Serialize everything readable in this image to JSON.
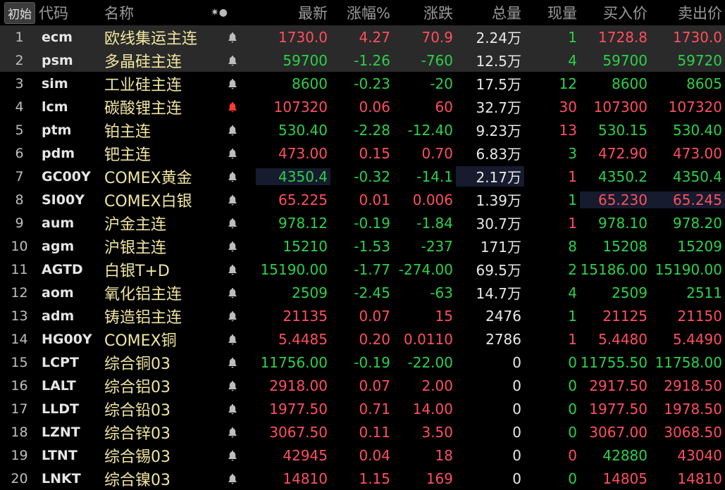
{
  "header": {
    "init_btn": "初始",
    "code": "代码",
    "name": "名称",
    "icons": "✷●",
    "last": "最新",
    "pct": "涨幅%",
    "chg": "涨跌",
    "vol": "总量",
    "cur": "现量",
    "bid": "买入价",
    "ask": "卖出价"
  },
  "colors": {
    "up": "#ff4f5e",
    "down": "#2bd14a",
    "name": "#f0e6a0"
  },
  "rows": [
    {
      "n": "1",
      "code": "ecm",
      "name": "欧线集运主连",
      "last": "1730.0",
      "pct": "4.27",
      "chg": "70.9",
      "vol": "2.24万",
      "cur": "1",
      "bid": "1728.8",
      "ask": "1730.0",
      "dir": "up",
      "curdir": "down",
      "bell": "gray"
    },
    {
      "n": "2",
      "code": "psm",
      "name": "多晶硅主连",
      "last": "59700",
      "pct": "-1.26",
      "chg": "-760",
      "vol": "12.5万",
      "cur": "4",
      "bid": "59700",
      "ask": "59720",
      "dir": "down",
      "curdir": "down",
      "bell": "gray"
    },
    {
      "n": "3",
      "code": "sim",
      "name": "工业硅主连",
      "last": "8600",
      "pct": "-0.23",
      "chg": "-20",
      "vol": "17.5万",
      "cur": "12",
      "bid": "8600",
      "ask": "8605",
      "dir": "down",
      "curdir": "down",
      "bell": "gray"
    },
    {
      "n": "4",
      "code": "lcm",
      "name": "碳酸锂主连",
      "last": "107320",
      "pct": "0.06",
      "chg": "60",
      "vol": "32.7万",
      "cur": "30",
      "bid": "107300",
      "ask": "107320",
      "dir": "up",
      "curdir": "up",
      "bell": "red"
    },
    {
      "n": "5",
      "code": "ptm",
      "name": "铂主连",
      "last": "530.40",
      "pct": "-2.28",
      "chg": "-12.40",
      "vol": "9.23万",
      "cur": "13",
      "bid": "530.15",
      "ask": "530.40",
      "dir": "down",
      "curdir": "up",
      "bell": "gray"
    },
    {
      "n": "6",
      "code": "pdm",
      "name": "钯主连",
      "last": "473.00",
      "pct": "0.15",
      "chg": "0.70",
      "vol": "6.83万",
      "cur": "3",
      "bid": "472.90",
      "ask": "473.00",
      "dir": "up",
      "curdir": "down",
      "bell": "gray"
    },
    {
      "n": "7",
      "code": "GC00Y",
      "name": "COMEX黄金",
      "last": "4350.4",
      "pct": "-0.32",
      "chg": "-14.1",
      "vol": "2.17万",
      "cur": "1",
      "bid": "4350.2",
      "ask": "4350.4",
      "dir": "down",
      "curdir": "up",
      "bell": "gray"
    },
    {
      "n": "8",
      "code": "SI00Y",
      "name": "COMEX白银",
      "last": "65.225",
      "pct": "0.01",
      "chg": "0.006",
      "vol": "1.39万",
      "cur": "1",
      "bid": "65.230",
      "ask": "65.245",
      "dir": "up",
      "curdir": "down",
      "bell": "gray"
    },
    {
      "n": "9",
      "code": "aum",
      "name": "沪金主连",
      "last": "978.12",
      "pct": "-0.19",
      "chg": "-1.84",
      "vol": "30.7万",
      "cur": "1",
      "bid": "978.10",
      "ask": "978.20",
      "dir": "down",
      "curdir": "up",
      "bell": "gray"
    },
    {
      "n": "10",
      "code": "agm",
      "name": "沪银主连",
      "last": "15210",
      "pct": "-1.53",
      "chg": "-237",
      "vol": "171万",
      "cur": "8",
      "bid": "15208",
      "ask": "15209",
      "dir": "down",
      "curdir": "down",
      "bell": "gray"
    },
    {
      "n": "11",
      "code": "AGTD",
      "name": "白银T+D",
      "last": "15190.00",
      "pct": "-1.77",
      "chg": "-274.00",
      "vol": "69.5万",
      "cur": "2",
      "bid": "15186.00",
      "ask": "15190.00",
      "dir": "down",
      "curdir": "down",
      "bell": "gray"
    },
    {
      "n": "12",
      "code": "aom",
      "name": "氧化铝主连",
      "last": "2509",
      "pct": "-2.45",
      "chg": "-63",
      "vol": "14.7万",
      "cur": "4",
      "bid": "2509",
      "ask": "2511",
      "dir": "down",
      "curdir": "down",
      "bell": "gray"
    },
    {
      "n": "13",
      "code": "adm",
      "name": "铸造铝主连",
      "last": "21135",
      "pct": "0.07",
      "chg": "15",
      "vol": "2476",
      "cur": "1",
      "bid": "21125",
      "ask": "21150",
      "dir": "up",
      "curdir": "down",
      "bell": "gray"
    },
    {
      "n": "14",
      "code": "HG00Y",
      "name": "COMEX铜",
      "last": "5.4485",
      "pct": "0.20",
      "chg": "0.0110",
      "vol": "2786",
      "cur": "1",
      "bid": "5.4480",
      "ask": "5.4490",
      "dir": "up",
      "curdir": "up",
      "bell": "gray"
    },
    {
      "n": "15",
      "code": "LCPT",
      "name": "综合铜03",
      "last": "11756.00",
      "pct": "-0.19",
      "chg": "-22.00",
      "vol": "0",
      "cur": "0",
      "bid": "11755.50",
      "ask": "11758.00",
      "dir": "down",
      "curdir": "down",
      "bell": "gray"
    },
    {
      "n": "16",
      "code": "LALT",
      "name": "综合铝03",
      "last": "2918.00",
      "pct": "0.07",
      "chg": "2.00",
      "vol": "0",
      "cur": "0",
      "bid": "2917.50",
      "ask": "2918.50",
      "dir": "up",
      "curdir": "down",
      "bell": "gray"
    },
    {
      "n": "17",
      "code": "LLDT",
      "name": "综合铅03",
      "last": "1977.50",
      "pct": "0.71",
      "chg": "14.00",
      "vol": "0",
      "cur": "0",
      "bid": "1977.50",
      "ask": "1978.50",
      "dir": "up",
      "curdir": "down",
      "bell": "gray"
    },
    {
      "n": "18",
      "code": "LZNT",
      "name": "综合锌03",
      "last": "3067.50",
      "pct": "0.11",
      "chg": "3.50",
      "vol": "0",
      "cur": "0",
      "bid": "3067.00",
      "ask": "3068.50",
      "dir": "up",
      "curdir": "down",
      "bell": "gray"
    },
    {
      "n": "19",
      "code": "LTNT",
      "name": "综合锡03",
      "last": "42945",
      "pct": "0.04",
      "chg": "18",
      "vol": "0",
      "cur": "0",
      "bid": "42880",
      "ask": "43040",
      "dir": "up",
      "curdir": "up",
      "bell": "gray",
      "biddir": "down"
    },
    {
      "n": "20",
      "code": "LNKT",
      "name": "综合镍03",
      "last": "14810",
      "pct": "1.15",
      "chg": "169",
      "vol": "0",
      "cur": "0",
      "bid": "14805",
      "ask": "14810",
      "dir": "up",
      "curdir": "down",
      "bell": "gray"
    }
  ]
}
